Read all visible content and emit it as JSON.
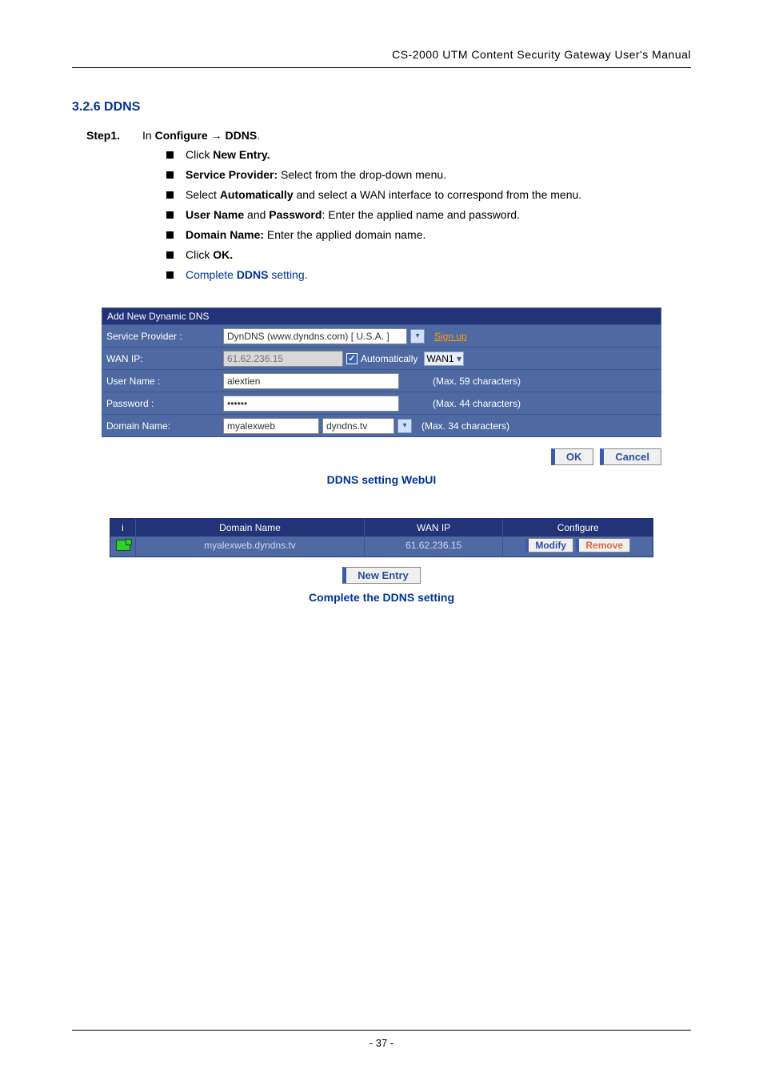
{
  "header": {
    "title": "CS-2000 UTM Content Security Gateway User's Manual"
  },
  "section": {
    "heading": "3.2.6 DDNS"
  },
  "step": {
    "label": "Step1.",
    "intro_prefix": "In ",
    "intro_bold1": "Configure",
    "intro_arrow": " → ",
    "intro_bold2": "DDNS",
    "intro_suffix": "."
  },
  "bullets": {
    "b1_prefix": "Click ",
    "b1_bold": "New Entry.",
    "b2_bold": "Service Provider:",
    "b2_text": " Select from the drop-down menu.",
    "b3_prefix": "Select ",
    "b3_bold": "Automatically",
    "b3_suffix": " and select a WAN interface to correspond from the menu.",
    "b4_bold1": "User Name",
    "b4_mid": " and ",
    "b4_bold2": "Password",
    "b4_suffix": ": Enter the applied name and password.",
    "b5_bold": "Domain Name:",
    "b5_text": " Enter the applied domain name.",
    "b6_prefix": "Click ",
    "b6_bold": "OK.",
    "b7_prefix": "Complete ",
    "b7_bold": "DDNS",
    "b7_suffix": " setting."
  },
  "form": {
    "panel_title": "Add New Dynamic DNS",
    "rows": {
      "provider": {
        "label": "Service Provider :",
        "value": "DynDNS (www.dyndns.com) [ U.S.A. ]",
        "signup": "Sign up"
      },
      "wanip": {
        "label": "WAN IP:",
        "value": "61.62.236.15",
        "auto_label": "Automatically",
        "wan_option": "WAN1"
      },
      "user": {
        "label": "User Name :",
        "value": "alextien",
        "hint": "(Max. 59 characters)"
      },
      "pass": {
        "label": "Password :",
        "value": "••••••",
        "hint": "(Max. 44 characters)"
      },
      "domain": {
        "label": "Domain Name:",
        "value": "myalexweb",
        "suffix_option": "dyndns.tv",
        "hint": "(Max. 34 characters)"
      }
    },
    "buttons": {
      "ok": "OK",
      "cancel": "Cancel"
    },
    "caption": "DDNS setting WebUI"
  },
  "table": {
    "head": {
      "i": "i",
      "domain": "Domain Name",
      "wan": "WAN IP",
      "cfg": "Configure"
    },
    "row": {
      "domain": "myalexweb.dyndns.tv",
      "wan": "61.62.236.15",
      "modify": "Modify",
      "remove": "Remove"
    },
    "new_entry": "New Entry",
    "caption": "Complete the DDNS setting"
  },
  "footer": {
    "page": "- 37 -"
  }
}
